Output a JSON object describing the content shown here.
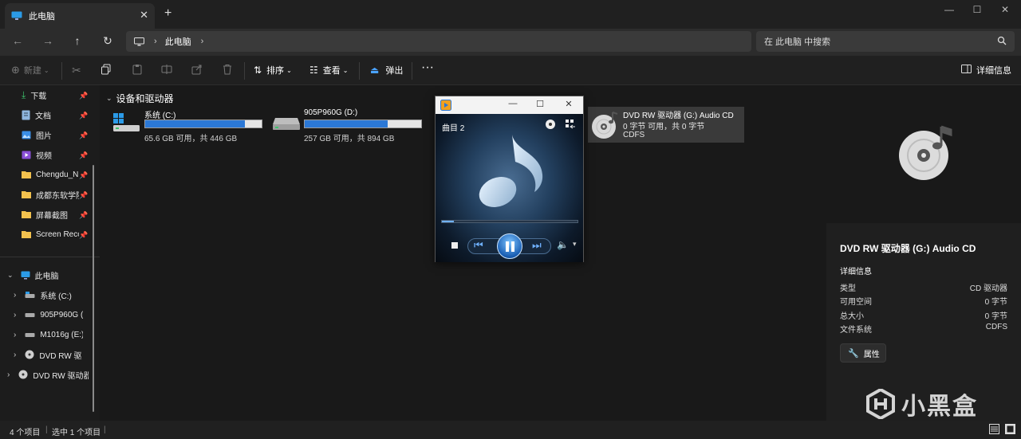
{
  "titlebar": {
    "tab_title": "此电脑",
    "new_tab": "+",
    "close_tab": "✕",
    "minimize": "—",
    "maximize": "☐",
    "close": "✕"
  },
  "address": {
    "crumb": "此电脑",
    "sep": "›",
    "search_placeholder": "在 此电脑 中搜索"
  },
  "toolbar": {
    "new": "新建",
    "sort": "排序",
    "view": "查看",
    "eject": "弹出",
    "more": "···",
    "details": "详细信息"
  },
  "sidebar": {
    "quick": [
      {
        "label": "下载",
        "icon": "download-icon"
      },
      {
        "label": "文档",
        "icon": "document-icon"
      },
      {
        "label": "图片",
        "icon": "picture-icon"
      },
      {
        "label": "视频",
        "icon": "video-icon"
      },
      {
        "label": "Chengdu_N",
        "icon": "folder-icon"
      },
      {
        "label": "成都东软学院",
        "icon": "folder-icon"
      },
      {
        "label": "屏幕截图",
        "icon": "folder-icon"
      },
      {
        "label": "Screen Reco",
        "icon": "folder-icon"
      }
    ],
    "pc": {
      "label": "此电脑"
    },
    "drives": [
      {
        "label": "系统 (C:)"
      },
      {
        "label": "905P960G (D"
      },
      {
        "label": "M1016g (E:)"
      },
      {
        "label": "DVD RW 驱动"
      }
    ],
    "cd_root": {
      "label": "DVD RW 驱动器"
    }
  },
  "main": {
    "group_title": "设备和驱动器",
    "drives": [
      {
        "name": "系统 (C:)",
        "size": "65.6 GB 可用，共 446 GB",
        "used_fraction": 0.853
      },
      {
        "name": "905P960G (D:)",
        "size": "257 GB 可用，共 894 GB",
        "used_fraction": 0.713
      }
    ],
    "cd": {
      "name": "DVD RW 驱动器 (G:) Audio CD",
      "free": "0 字节 可用，共 0 字节",
      "fs": "CDFS"
    }
  },
  "details": {
    "title": "DVD RW 驱动器 (G:) Audio CD",
    "section": "详细信息",
    "props": [
      {
        "k": "类型",
        "v": "CD 驱动器"
      },
      {
        "k": "可用空间",
        "v": "0 字节"
      },
      {
        "k": "总大小",
        "v": "0 字节"
      },
      {
        "k": "文件系统",
        "v": "CDFS"
      }
    ],
    "props_button": "属性",
    "watermark": "小黑盒"
  },
  "status": {
    "count": "4 个项目",
    "selected": "选中 1 个项目"
  },
  "player": {
    "track": "曲目 2",
    "progress": 0.09
  },
  "colors": {
    "accent": "#2b78d6",
    "folder": "#f2c14e"
  }
}
